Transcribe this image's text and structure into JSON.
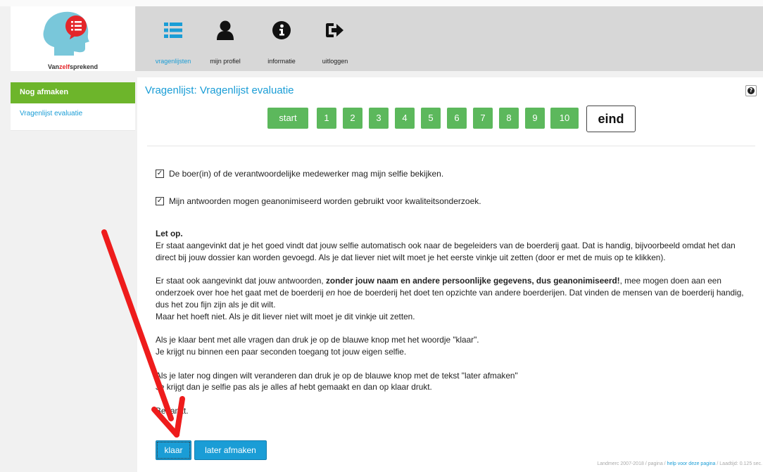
{
  "brand": {
    "prefix": "Van",
    "highlight": "zelf",
    "suffix": "sprekend"
  },
  "nav": [
    {
      "label": "vragenlijsten",
      "icon": "list-icon",
      "active": true
    },
    {
      "label": "mijn profiel",
      "icon": "user-icon",
      "active": false
    },
    {
      "label": "informatie",
      "icon": "info-icon",
      "active": false
    },
    {
      "label": "uitloggen",
      "icon": "logout-icon",
      "active": false
    }
  ],
  "sidebar": {
    "header": "Nog afmaken",
    "items": [
      {
        "label": "Vragenlijst evaluatie"
      }
    ]
  },
  "page": {
    "title": "Vragenlijst: Vragenlijst evaluatie",
    "help": "?",
    "pages": [
      "start",
      "1",
      "2",
      "3",
      "4",
      "5",
      "6",
      "7",
      "8",
      "9",
      "10",
      "eind"
    ]
  },
  "checks": [
    {
      "label": "De boer(in) of de verantwoordelijke medewerker mag mijn selfie bekijken.",
      "checked": true
    },
    {
      "label": "Mijn antwoorden mogen geanonimiseerd worden gebruikt voor kwaliteitsonderzoek.",
      "checked": true
    }
  ],
  "text": {
    "heading": "Let op.",
    "p1": "Er staat aangevinkt dat je het goed vindt dat jouw selfie automatisch ook naar de begeleiders van de boerderij gaat. Dat is handig, bijvoorbeeld omdat het dan direct bij jouw dossier kan worden gevoegd. Als je dat liever niet wilt moet je het eerste vinkje uit zetten (door er met de muis op te klikken).",
    "p2a": "Er staat ook aangevinkt dat jouw antwoorden, ",
    "p2b": "zonder jouw naam en andere persoonlijke gegevens, dus geanonimiseerd!",
    "p2c": ", mee mogen doen aan een onderzoek over hoe het gaat met de boerderij ",
    "p2d": "en",
    "p2e": " hoe de boerderij het doet ten opzichte van andere boerderijen. Dat vinden de mensen van de boerderij handig, dus het zou fijn zijn als je dit wilt.",
    "p2f": "Maar het hoeft niet. Als je dit liever niet wilt moet je dit vinkje uit zetten.",
    "p3a": "Als je klaar bent met alle vragen dan druk je op de blauwe knop met het woordje \"klaar\".",
    "p3b": "Je krijgt nu binnen een paar seconden toegang tot jouw eigen selfie.",
    "p4a": "Als je later nog dingen wilt veranderen dan druk je op de blauwe knop met de tekst \"later afmaken\"",
    "p4b": "Je krijgt dan je selfie pas als je alles af hebt gemaakt en dan op klaar drukt.",
    "thanks": "Bedankt."
  },
  "buttons": {
    "done": "klaar",
    "later": "later afmaken"
  },
  "footer": {
    "prefix": "Landmerc 2007-2018 / pagina / ",
    "link": "help voor deze pagina",
    "suffix": " / Laadtijd: 0.125 sec."
  },
  "colors": {
    "accent": "#1a9dd6",
    "green": "#5cb85c",
    "sidebar_green": "#6db52b",
    "arrow": "#ee1c1c",
    "logo_red": "#e4262a",
    "logo_head": "#79c7da"
  }
}
